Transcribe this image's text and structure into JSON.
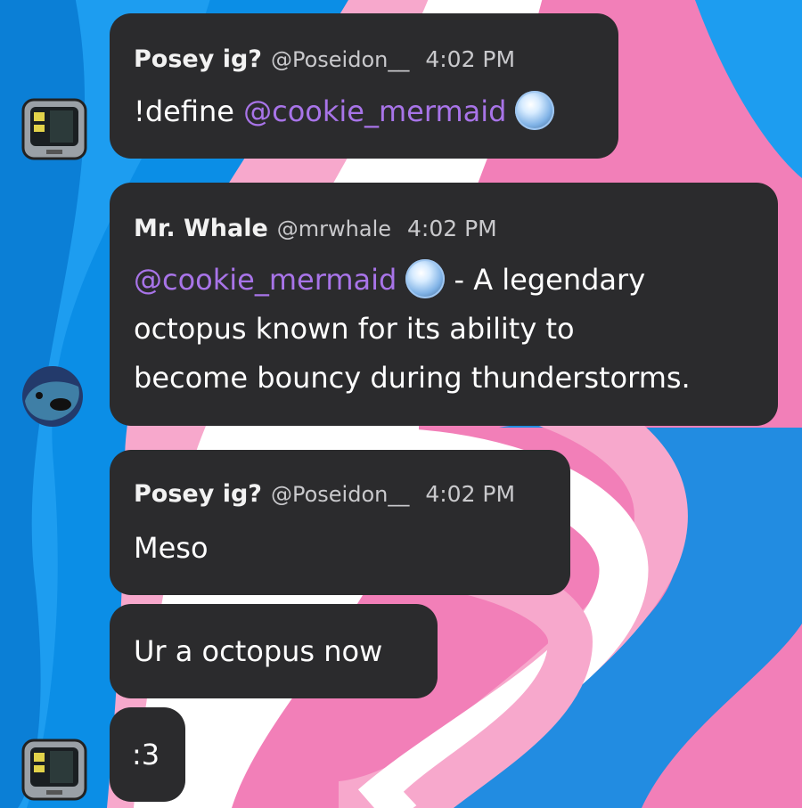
{
  "messages": [
    {
      "author": "Posey ig?",
      "handle": "@Poseidon__",
      "time": "4:02 PM",
      "mention": "@cookie_mermaid",
      "text": "!define"
    },
    {
      "author": "Mr. Whale",
      "handle": "@mrwhale",
      "time": "4:02 PM",
      "mention": "@cookie_mermaid",
      "lines": [
        "- A legendary",
        "octopus known for its ability to",
        "become bouncy during thunderstorms."
      ]
    },
    {
      "author": "Posey ig?",
      "handle": "@Poseidon__",
      "time": "4:02 PM",
      "text": "Meso"
    },
    {
      "text": "Ur a octopus now"
    },
    {
      "text": ":3"
    }
  ],
  "colors": {
    "bubble": "#2b2b2d",
    "mention": "#a874e8",
    "bg_blue": "#0b8ee6",
    "bg_pink": "#f27fb8",
    "bg_white": "#ffffff"
  },
  "icons": {
    "mermaid_emoji": "mermaid-emoji-icon",
    "posey_avatar": "tv-avatar-icon",
    "whale_avatar": "whale-avatar-icon"
  }
}
